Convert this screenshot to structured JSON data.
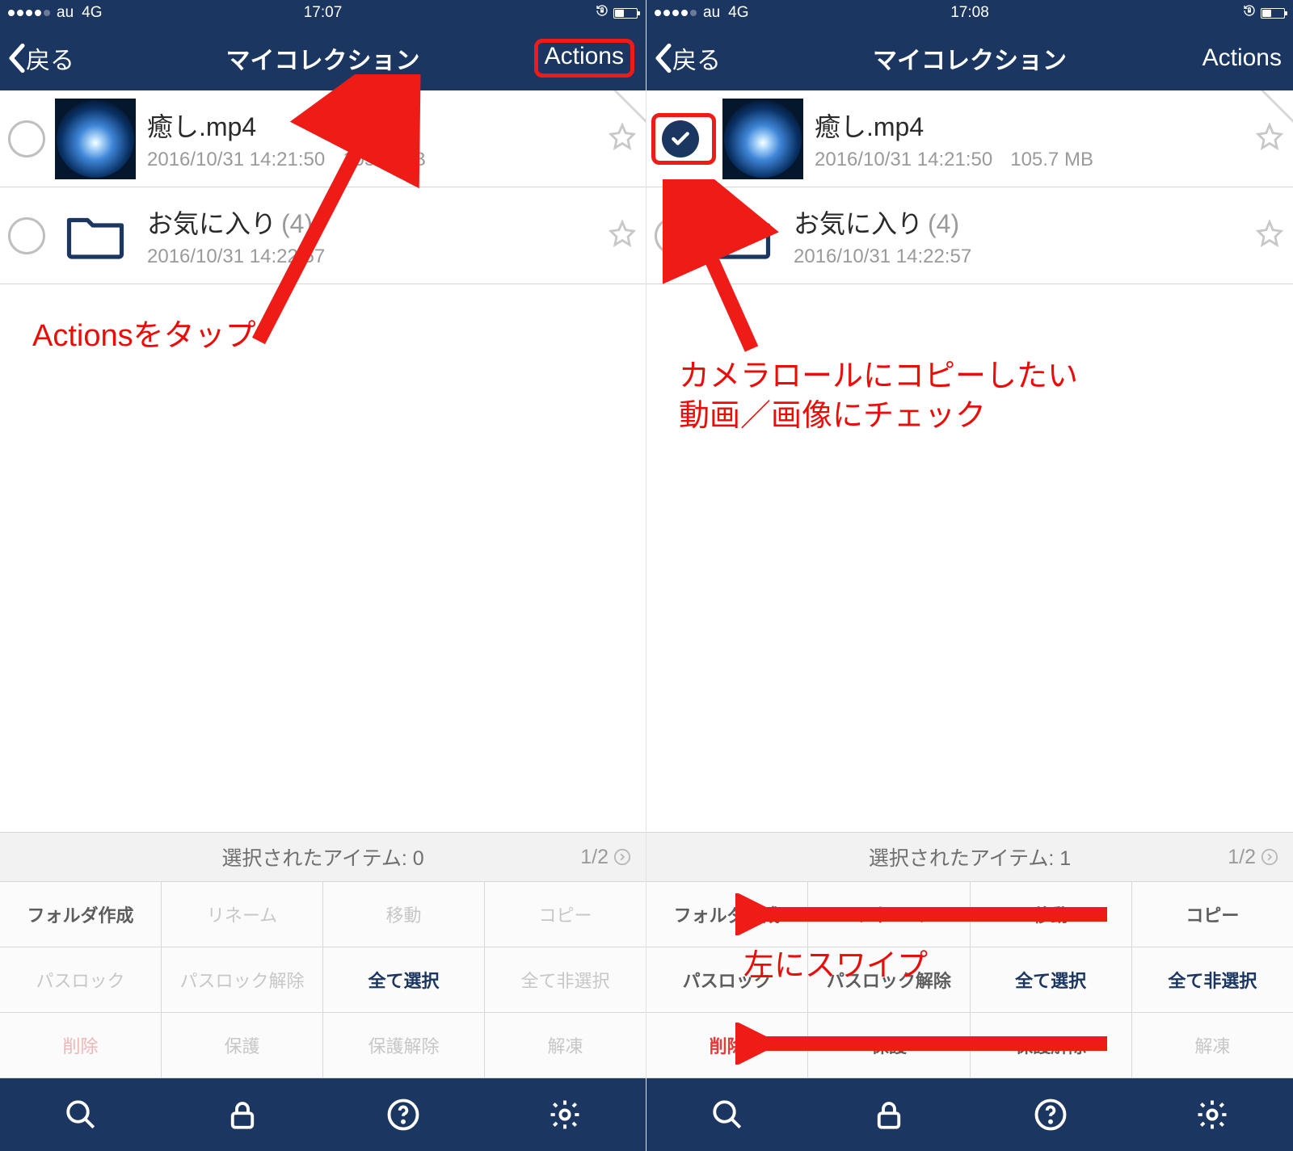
{
  "left": {
    "status": {
      "carrier": "au",
      "network": "4G",
      "time": "17:07"
    },
    "nav": {
      "back": "戻る",
      "title": "マイコレクション",
      "actions": "Actions"
    },
    "rows": [
      {
        "title": "癒し.mp4",
        "date": "2016/10/31 14:21:50",
        "size": "105.7 MB"
      },
      {
        "title": "お気に入り",
        "count": "(4)",
        "date": "2016/10/31 14:22:57"
      }
    ],
    "annotation1": "Actionsをタップ",
    "selbar": {
      "label": "選択されたアイテム: 0",
      "page": "1/2"
    },
    "grid": [
      "フォルダ作成",
      "リネーム",
      "移動",
      "コピー",
      "パスロック",
      "パスロック解除",
      "全て選択",
      "全て非選択",
      "削除",
      "保護",
      "保護解除",
      "解凍"
    ]
  },
  "right": {
    "status": {
      "carrier": "au",
      "network": "4G",
      "time": "17:08"
    },
    "nav": {
      "back": "戻る",
      "title": "マイコレクション",
      "actions": "Actions"
    },
    "rows": [
      {
        "title": "癒し.mp4",
        "date": "2016/10/31 14:21:50",
        "size": "105.7 MB"
      },
      {
        "title": "お気に入り",
        "count": "(4)",
        "date": "2016/10/31 14:22:57"
      }
    ],
    "annotation2": "カメラロールにコピーしたい\n動画／画像にチェック",
    "annotation3": "左にスワイプ",
    "selbar": {
      "label": "選択されたアイテム: 1",
      "page": "1/2"
    },
    "grid": [
      "フォルダ作成",
      "リネーム",
      "移動",
      "コピー",
      "パスロック",
      "パスロック解除",
      "全て選択",
      "全て非選択",
      "削除",
      "保護",
      "保護解除",
      "解凍"
    ]
  }
}
